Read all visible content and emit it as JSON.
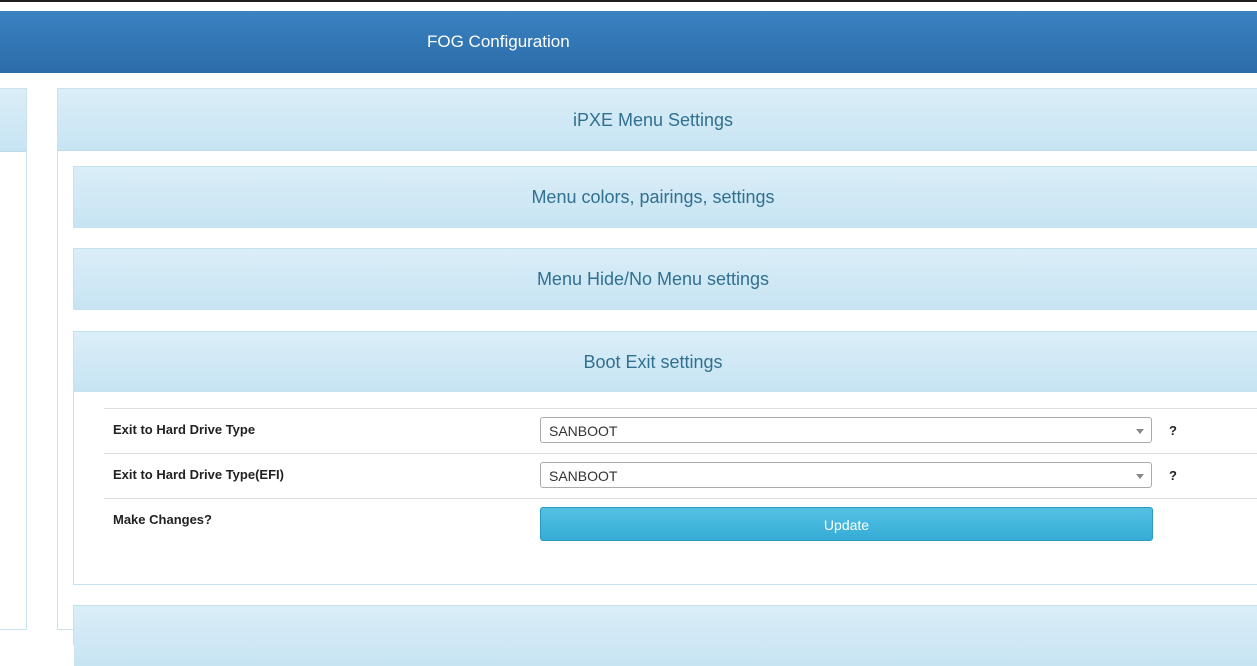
{
  "navbar": {
    "title": "FOG Configuration"
  },
  "main_panel": {
    "title": "iPXE Menu Settings",
    "sections": [
      {
        "title": "Menu colors, pairings, settings"
      },
      {
        "title": "Menu Hide/No Menu settings"
      },
      {
        "title": "Boot Exit settings"
      }
    ]
  },
  "boot_exit": {
    "rows": [
      {
        "label": "Exit to Hard Drive Type",
        "value": "SANBOOT",
        "help": "?"
      },
      {
        "label": "Exit to Hard Drive Type(EFI)",
        "value": "SANBOOT",
        "help": "?"
      }
    ],
    "make_changes_label": "Make Changes?",
    "update_label": "Update"
  },
  "colors": {
    "navbar": "#2f75b5",
    "panel_heading_text": "#31708f",
    "panel_heading_bg": "#d4ebf7",
    "button_bg": "#3ab0d9"
  },
  "icons": {
    "select_arrow": "chevron-down-icon"
  }
}
